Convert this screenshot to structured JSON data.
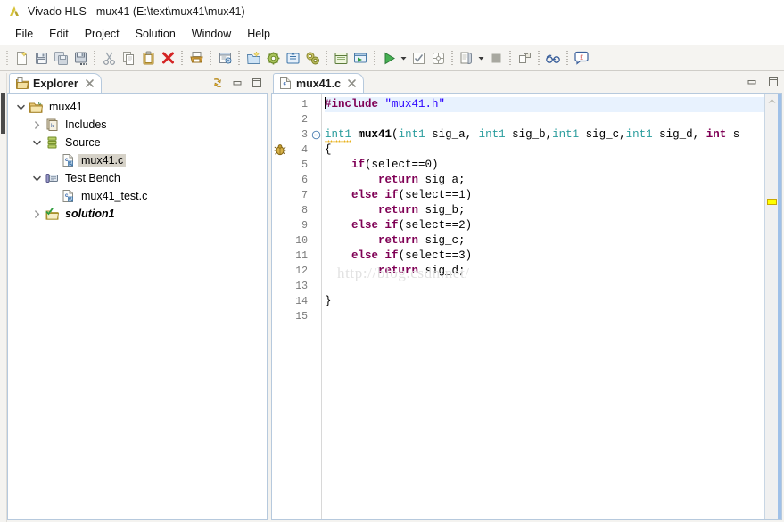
{
  "window": {
    "title": "Vivado HLS - mux41 (E:\\text\\mux41\\mux41)",
    "app_icon": "vivado-logo-icon"
  },
  "menubar": {
    "items": [
      {
        "label": "File"
      },
      {
        "label": "Edit"
      },
      {
        "label": "Project"
      },
      {
        "label": "Solution"
      },
      {
        "label": "Window"
      },
      {
        "label": "Help"
      }
    ]
  },
  "toolbar": {
    "groups": [
      {
        "buttons": [
          {
            "name": "new-button",
            "icon": "new-file-icon",
            "tooltip": "New"
          },
          {
            "name": "save-button",
            "icon": "save-icon",
            "tooltip": "Save"
          },
          {
            "name": "save-all-button",
            "icon": "save-all-icon",
            "tooltip": "Save All"
          },
          {
            "name": "save-as-button",
            "icon": "save-as-icon",
            "tooltip": "Save As"
          }
        ]
      },
      {
        "buttons": [
          {
            "name": "cut-button",
            "icon": "scissors-icon",
            "tooltip": "Cut"
          },
          {
            "name": "copy-button",
            "icon": "copy-icon",
            "tooltip": "Copy"
          },
          {
            "name": "paste-button",
            "icon": "clipboard-icon",
            "tooltip": "Paste"
          },
          {
            "name": "delete-button",
            "icon": "red-x-icon",
            "tooltip": "Delete"
          }
        ]
      },
      {
        "buttons": [
          {
            "name": "print-button",
            "icon": "printer-icon",
            "tooltip": "Print"
          }
        ]
      },
      {
        "buttons": [
          {
            "name": "new-source-button",
            "icon": "new-source-icon",
            "tooltip": "New Source"
          }
        ]
      },
      {
        "buttons": [
          {
            "name": "new-solution-button",
            "icon": "new-solution-folder-icon",
            "tooltip": "New Solution"
          },
          {
            "name": "project-settings-button",
            "icon": "gear-icon",
            "tooltip": "Project Settings"
          },
          {
            "name": "open-ip-button",
            "icon": "open-ip-icon",
            "tooltip": "Open IP"
          },
          {
            "name": "solution-settings-button",
            "icon": "gears-icon",
            "tooltip": "Solution Settings"
          }
        ]
      },
      {
        "buttons": [
          {
            "name": "index-button",
            "icon": "index-icon",
            "tooltip": "Index"
          },
          {
            "name": "run-simulation-button",
            "icon": "run-simulation-icon",
            "tooltip": "Run C Simulation"
          }
        ]
      },
      {
        "buttons": [
          {
            "name": "run-button",
            "icon": "green-play-icon",
            "tooltip": "Run"
          },
          {
            "name": "run-dropdown",
            "icon": "chevron-down-icon",
            "tooltip": "Run menu"
          },
          {
            "name": "csynthesis-button",
            "icon": "checkbox-icon",
            "tooltip": "C Synthesis"
          },
          {
            "name": "rtl-export-button",
            "icon": "grid-icon",
            "tooltip": "Export RTL"
          }
        ]
      },
      {
        "buttons": [
          {
            "name": "reports-button",
            "icon": "reports-icon",
            "tooltip": "Open Report"
          },
          {
            "name": "reports-dropdown",
            "icon": "chevron-down-icon",
            "tooltip": "Report menu"
          },
          {
            "name": "stop-button",
            "icon": "stop-square-icon",
            "tooltip": "Stop"
          }
        ]
      },
      {
        "buttons": [
          {
            "name": "perspective-button",
            "icon": "perspective-icon",
            "tooltip": "Open Perspective"
          }
        ]
      },
      {
        "buttons": [
          {
            "name": "analysis-button",
            "icon": "glasses-icon",
            "tooltip": "Analysis"
          }
        ]
      },
      {
        "buttons": [
          {
            "name": "pragma-button",
            "icon": "pragma-balloon-icon",
            "tooltip": "Directive"
          }
        ]
      }
    ]
  },
  "explorer": {
    "tab_label": "Explorer",
    "tab_icon": "explorer-folder-icon",
    "close_icon": "close-icon",
    "tools": [
      {
        "name": "link-with-editor-button",
        "icon": "link-arrows-icon"
      },
      {
        "name": "minimize-view-button",
        "icon": "minimize-icon"
      },
      {
        "name": "maximize-view-button",
        "icon": "maximize-icon"
      }
    ],
    "tree": [
      {
        "label": "mux41",
        "indent": 0,
        "twist": "expanded",
        "icon": "project-folder-icon",
        "selected": false,
        "style": "normal"
      },
      {
        "label": "Includes",
        "indent": 1,
        "twist": "collapsed",
        "icon": "includes-icon",
        "selected": false,
        "style": "normal"
      },
      {
        "label": "Source",
        "indent": 1,
        "twist": "expanded",
        "icon": "source-group-icon",
        "selected": false,
        "style": "normal"
      },
      {
        "label": "mux41.c",
        "indent": 2,
        "twist": "none",
        "icon": "c-file-icon",
        "selected": true,
        "style": "normal"
      },
      {
        "label": "Test Bench",
        "indent": 1,
        "twist": "expanded",
        "icon": "testbench-icon",
        "selected": false,
        "style": "normal"
      },
      {
        "label": "mux41_test.c",
        "indent": 2,
        "twist": "none",
        "icon": "c-file-icon",
        "selected": false,
        "style": "normal"
      },
      {
        "label": "solution1",
        "indent": 1,
        "twist": "collapsed",
        "icon": "solution-folder-icon",
        "selected": false,
        "style": "italicbold"
      }
    ]
  },
  "editor": {
    "tab_label": "mux41.c",
    "tab_icon": "c-file-icon",
    "close_icon": "close-icon",
    "watermark": "http://blog.csdn.net/",
    "gutter_marker": {
      "line": 3,
      "icon": "bug-warning-icon"
    },
    "overview_marker": {
      "line": 3,
      "color": "#ffff00"
    },
    "line_numbers": [
      "1",
      "2",
      "3",
      "4",
      "5",
      "6",
      "7",
      "8",
      "9",
      "10",
      "11",
      "12",
      "13",
      "14",
      "15"
    ],
    "fold_markers": {
      "3": "fold-collapse-icon"
    },
    "highlight_line": 1,
    "lines": [
      {
        "n": 1,
        "tokens": [
          {
            "t": "caret",
            "v": ""
          },
          {
            "t": "pre",
            "v": "#include"
          },
          {
            "t": "pl",
            "v": " "
          },
          {
            "t": "str",
            "v": "\"mux41.h\""
          }
        ]
      },
      {
        "n": 2,
        "tokens": []
      },
      {
        "n": 3,
        "tokens": [
          {
            "t": "type-sq",
            "v": "int1"
          },
          {
            "t": "pl",
            "v": " "
          },
          {
            "t": "fn",
            "v": "mux41"
          },
          {
            "t": "pl",
            "v": "("
          },
          {
            "t": "type",
            "v": "int1"
          },
          {
            "t": "pl",
            "v": " sig_a, "
          },
          {
            "t": "type",
            "v": "int1"
          },
          {
            "t": "pl",
            "v": " sig_b,"
          },
          {
            "t": "type",
            "v": "int1"
          },
          {
            "t": "pl",
            "v": " sig_c,"
          },
          {
            "t": "type",
            "v": "int1"
          },
          {
            "t": "pl",
            "v": " sig_d, "
          },
          {
            "t": "kw",
            "v": "int"
          },
          {
            "t": "pl",
            "v": " s"
          }
        ]
      },
      {
        "n": 4,
        "tokens": [
          {
            "t": "pl",
            "v": "{"
          }
        ]
      },
      {
        "n": 5,
        "tokens": [
          {
            "t": "pl",
            "v": "    "
          },
          {
            "t": "kw",
            "v": "if"
          },
          {
            "t": "pl",
            "v": "(select==0)"
          }
        ]
      },
      {
        "n": 6,
        "tokens": [
          {
            "t": "pl",
            "v": "        "
          },
          {
            "t": "kw",
            "v": "return"
          },
          {
            "t": "pl",
            "v": " sig_a;"
          }
        ]
      },
      {
        "n": 7,
        "tokens": [
          {
            "t": "pl",
            "v": "    "
          },
          {
            "t": "kw",
            "v": "else"
          },
          {
            "t": "pl",
            "v": " "
          },
          {
            "t": "kw",
            "v": "if"
          },
          {
            "t": "pl",
            "v": "(select==1)"
          }
        ]
      },
      {
        "n": 8,
        "tokens": [
          {
            "t": "pl",
            "v": "        "
          },
          {
            "t": "kw",
            "v": "return"
          },
          {
            "t": "pl",
            "v": " sig_b;"
          }
        ]
      },
      {
        "n": 9,
        "tokens": [
          {
            "t": "pl",
            "v": "    "
          },
          {
            "t": "kw",
            "v": "else"
          },
          {
            "t": "pl",
            "v": " "
          },
          {
            "t": "kw",
            "v": "if"
          },
          {
            "t": "pl",
            "v": "(select==2)"
          }
        ]
      },
      {
        "n": 10,
        "tokens": [
          {
            "t": "pl",
            "v": "        "
          },
          {
            "t": "kw",
            "v": "return"
          },
          {
            "t": "pl",
            "v": " sig_c;"
          }
        ]
      },
      {
        "n": 11,
        "tokens": [
          {
            "t": "pl",
            "v": "    "
          },
          {
            "t": "kw",
            "v": "else"
          },
          {
            "t": "pl",
            "v": " "
          },
          {
            "t": "kw",
            "v": "if"
          },
          {
            "t": "pl",
            "v": "(select==3)"
          }
        ]
      },
      {
        "n": 12,
        "tokens": [
          {
            "t": "pl",
            "v": "        "
          },
          {
            "t": "kw",
            "v": "return"
          },
          {
            "t": "pl",
            "v": " sig_d;"
          }
        ]
      },
      {
        "n": 13,
        "tokens": []
      },
      {
        "n": 14,
        "tokens": [
          {
            "t": "pl",
            "v": "}"
          }
        ]
      },
      {
        "n": 15,
        "tokens": []
      }
    ],
    "tools": [
      {
        "name": "minimize-editor-button",
        "icon": "minimize-icon"
      },
      {
        "name": "maximize-editor-button",
        "icon": "maximize-icon"
      }
    ]
  },
  "colors": {
    "keyword": "#7f0055",
    "string": "#2a00ff",
    "user_type": "#2a9d9d",
    "warning_marker": "#ffff00",
    "selection": "#d6d2c8",
    "tab_border": "#b6c9dd",
    "current_line": "#e8f2fe"
  }
}
